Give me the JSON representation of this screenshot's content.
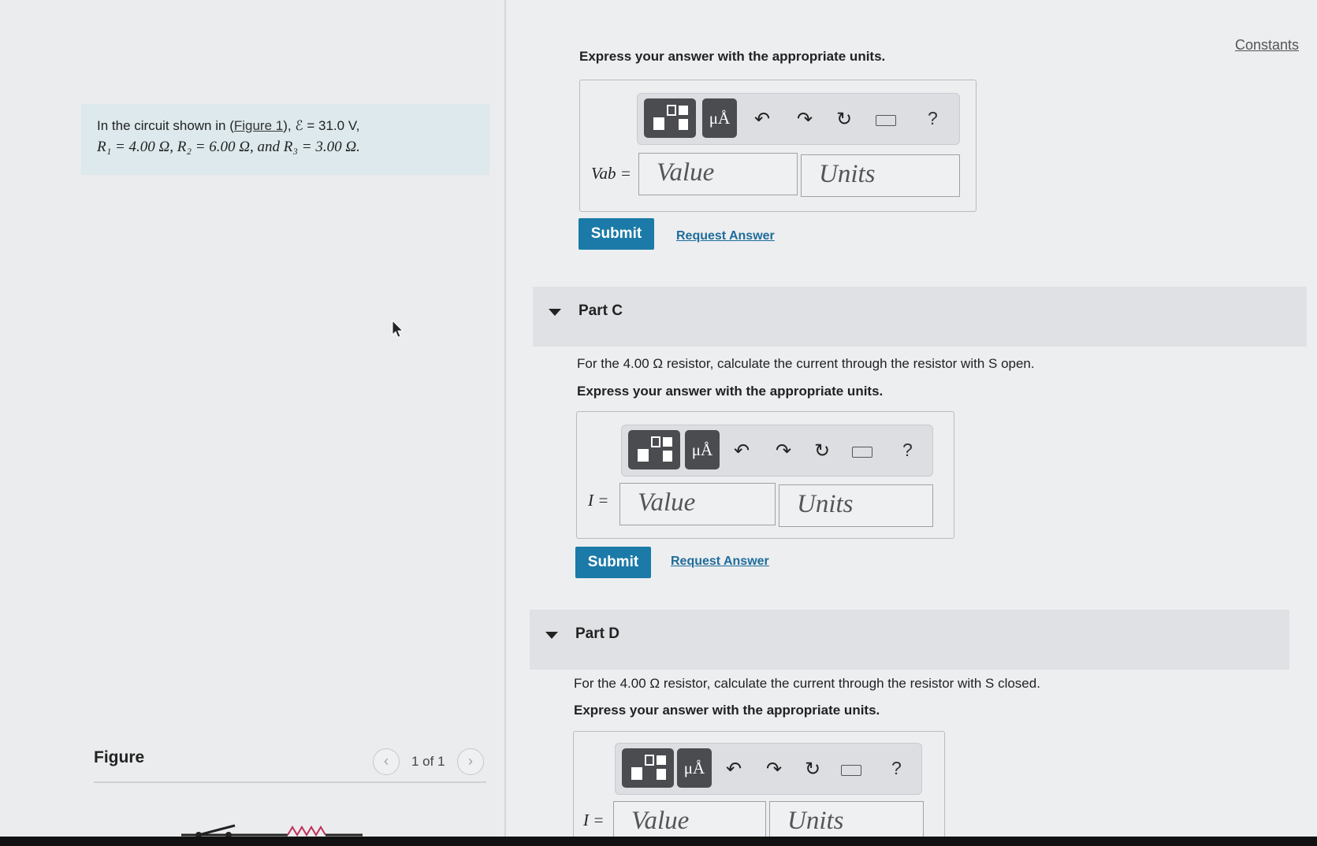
{
  "problem": {
    "intro": "In the circuit shown in (",
    "figure_link": "Figure 1",
    "emf_text": "), ℰ = 31.0 V,",
    "resistors_text": "R₁ = 4.00 Ω, R₂ = 6.00 Ω, and R₃ = 3.00 Ω."
  },
  "figure": {
    "label": "Figure",
    "count": "1 of 1",
    "prev": "‹",
    "next": "›"
  },
  "constants_link": "Constants",
  "toolbar": {
    "units_btn": "μÅ",
    "undo": "↶",
    "redo": "↷",
    "reset": "↻",
    "help": "?"
  },
  "part_b": {
    "instruction": "Express your answer with the appropriate units.",
    "var_label": "Vab =",
    "value_placeholder": "Value",
    "units_placeholder": "Units",
    "submit": "Submit",
    "request": "Request Answer"
  },
  "part_c": {
    "title": "Part C",
    "question": "For the 4.00 Ω resistor, calculate the current through the resistor with S open.",
    "instruction": "Express your answer with the appropriate units.",
    "var_label": "I =",
    "value_placeholder": "Value",
    "units_placeholder": "Units",
    "submit": "Submit",
    "request": "Request Answer"
  },
  "part_d": {
    "title": "Part D",
    "question": "For the 4.00 Ω resistor, calculate the current through the resistor with S closed.",
    "instruction": "Express your answer with the appropriate units.",
    "var_label": "I =",
    "value_placeholder": "Value",
    "units_placeholder": "Units"
  }
}
